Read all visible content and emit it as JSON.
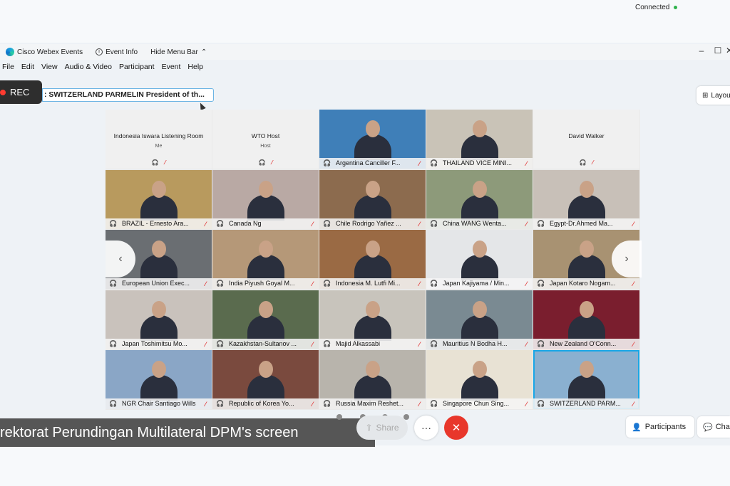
{
  "titlebar": {
    "app_name": "Cisco Webex Events",
    "event_info": "Event Info",
    "hide_menu": "Hide Menu Bar",
    "status": "Connected"
  },
  "menu": [
    "File",
    "Edit",
    "View",
    "Audio & Video",
    "Participant",
    "Event",
    "Help"
  ],
  "rec_label": "REC",
  "share_name": ": SWITZERLAND PARMELIN President of th...",
  "layout_label": "Layou",
  "tiles": [
    {
      "name": "Indonesia Iswara Listening Room",
      "sub": "Me",
      "blank": true
    },
    {
      "name": "WTO Host",
      "sub": "Host",
      "blank": true
    },
    {
      "name": "Argentina Canciller F...",
      "bg": "#3f7fb8"
    },
    {
      "name": "THAILAND VICE MINI...",
      "bg": "#c9c3b7"
    },
    {
      "name": "David Walker",
      "sub": "",
      "blank": true
    },
    {
      "name": "BRAZIL - Ernesto Ara...",
      "bg": "#b89a5e"
    },
    {
      "name": "Canada Ng",
      "bg": "#b9a9a4"
    },
    {
      "name": "Chile Rodrigo Yañez ...",
      "bg": "#8c6b4e"
    },
    {
      "name": "China WANG Wenta...",
      "bg": "#8d9a7a"
    },
    {
      "name": "Egypt-Dr.Ahmed Ma...",
      "bg": "#c8c0b8"
    },
    {
      "name": "European Union Exec...",
      "bg": "#6a6e72"
    },
    {
      "name": "India Piyush Goyal M...",
      "bg": "#b59878"
    },
    {
      "name": "Indonesia M. Lutfi Mi...",
      "bg": "#9a6a44"
    },
    {
      "name": "Japan Kajiyama / Min...",
      "bg": "#e4e6e8"
    },
    {
      "name": "Japan Kotaro Nogam...",
      "bg": "#a89272"
    },
    {
      "name": "Japan Toshimitsu Mo...",
      "bg": "#c9c2bc"
    },
    {
      "name": "Kazakhstan-Sultanov ...",
      "bg": "#5a6b4e"
    },
    {
      "name": "Majid Alkassabi",
      "bg": "#c8c4bc"
    },
    {
      "name": "Mauritius N Bodha H...",
      "bg": "#7a8a92"
    },
    {
      "name": "New Zealand O'Conn...",
      "bg": "#7a1e2e"
    },
    {
      "name": "NGR Chair Santiago Wills",
      "bg": "#8aa6c6"
    },
    {
      "name": "Republic of Korea Yo...",
      "bg": "#7a4a3e"
    },
    {
      "name": "Russia Maxim Reshet...",
      "bg": "#b8b4ac"
    },
    {
      "name": "Singapore Chun Sing...",
      "bg": "#e8e2d4"
    },
    {
      "name": "SWITZERLAND PARM...",
      "bg": "#8ab0d0",
      "active": true
    }
  ],
  "caption": "rektorat Perundingan Multilateral DPM's screen",
  "controls": {
    "share": "Share",
    "participants": "Participants",
    "chat": "Cha"
  },
  "colors": {
    "leave": "#e8372b",
    "active_outline": "#19a7e6",
    "rec_dot": "#ff3b30",
    "mute": "#e23c3c"
  },
  "icons": {
    "headset": "headset-icon",
    "mute": "mic-muted-icon",
    "more": "more-icon",
    "leave": "close-icon"
  }
}
